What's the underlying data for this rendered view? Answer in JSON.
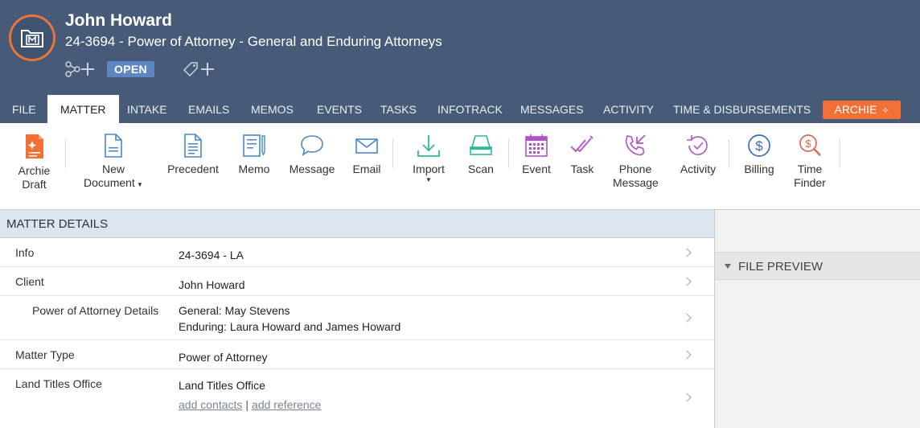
{
  "header": {
    "client_name": "John Howard",
    "matter_title": "24-3694 - Power of Attorney - General and Enduring Attorneys",
    "status": "OPEN",
    "brand_color": "#475b78",
    "accent_color": "#e8743b"
  },
  "tabs": [
    {
      "label": "FILE"
    },
    {
      "label": "MATTER"
    },
    {
      "label": "INTAKE"
    },
    {
      "label": "EMAILS"
    },
    {
      "label": "MEMOS"
    },
    {
      "label": "EVENTS"
    },
    {
      "label": "TASKS"
    },
    {
      "label": "INFOTRACK"
    },
    {
      "label": "MESSAGES"
    },
    {
      "label": "ACTIVITY"
    },
    {
      "label": "TIME & DISBURSEMENTS"
    }
  ],
  "archie_tab": "ARCHIE",
  "toolbar": {
    "archie_draft_1": "Archie",
    "archie_draft_2": "Draft",
    "new_document_1": "New",
    "new_document_2": "Document",
    "precedent": "Precedent",
    "memo": "Memo",
    "message": "Message",
    "email": "Email",
    "import": "Import",
    "scan": "Scan",
    "event": "Event",
    "task": "Task",
    "phone_message_1": "Phone",
    "phone_message_2": "Message",
    "activity": "Activity",
    "billing": "Billing",
    "time_finder_1": "Time",
    "time_finder_2": "Finder"
  },
  "matter_details": {
    "heading": "MATTER DETAILS",
    "rows": [
      {
        "label": "Info",
        "value": "24-3694 - LA"
      },
      {
        "label": "Client",
        "value": "John Howard"
      },
      {
        "label": "Power of Attorney Details",
        "value_1": "General: May Stevens",
        "value_2": "Enduring: Laura Howard and James Howard"
      },
      {
        "label": "Matter Type",
        "value": "Power of Attorney"
      },
      {
        "label": "Land Titles Office",
        "value": "Land Titles Office",
        "link_1": "add contacts",
        "separator": "|",
        "link_2": "add reference"
      }
    ]
  },
  "file_preview": {
    "heading": "FILE PREVIEW"
  }
}
